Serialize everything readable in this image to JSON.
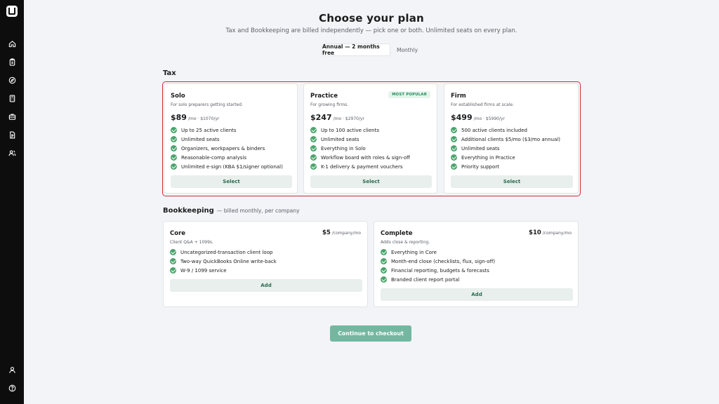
{
  "header": {
    "title": "Choose your plan",
    "subtitle": "Tax and Bookkeeping are billed independently — pick one or both. Unlimited seats on every plan."
  },
  "billing_toggle": {
    "annual_label": "Annual — 2 months free",
    "monthly_label": "Monthly",
    "selected": "annual"
  },
  "tax": {
    "section_label": "Tax",
    "plans": [
      {
        "name": "Solo",
        "description": "For solo preparers getting started.",
        "price": "$89",
        "price_unit": "/mo · $1070/yr",
        "features": [
          "Up to 25 active clients",
          "Unlimited seats",
          "Organizers, workpapers & binders",
          "Reasonable-comp analysis",
          "Unlimited e-sign (KBA $1/signer optional)"
        ],
        "button_label": "Select"
      },
      {
        "name": "Practice",
        "description": "For growing firms.",
        "badge": "MOST POPULAR",
        "price": "$247",
        "price_unit": "/mo · $2970/yr",
        "features": [
          "Up to 100 active clients",
          "Unlimited seats",
          "Everything in Solo",
          "Workflow board with roles & sign-off",
          "K-1 delivery & payment vouchers"
        ],
        "button_label": "Select"
      },
      {
        "name": "Firm",
        "description": "For established firms at scale.",
        "price": "$499",
        "price_unit": "/mo · $5990/yr",
        "features": [
          "500 active clients included",
          "Additional clients $5/mo ($3/mo annual)",
          "Unlimited seats",
          "Everything in Practice",
          "Priority support"
        ],
        "button_label": "Select"
      }
    ]
  },
  "bookkeeping": {
    "section_label": "Bookkeeping",
    "section_note": "— billed monthly, per company",
    "plans": [
      {
        "name": "Core",
        "description": "Client Q&A + 1099s.",
        "price": "$5",
        "price_unit": "/company/mo",
        "features": [
          "Uncategorized-transaction client loop",
          "Two-way QuickBooks Online write-back",
          "W-9 / 1099 service"
        ],
        "button_label": "Add"
      },
      {
        "name": "Complete",
        "description": "Adds close & reporting.",
        "price": "$10",
        "price_unit": "/company/mo",
        "features": [
          "Everything in Core",
          "Month-end close (checklists, flux, sign-off)",
          "Financial reporting, budgets & forecasts",
          "Branded client report portal"
        ],
        "button_label": "Add"
      }
    ]
  },
  "checkout": {
    "label": "Continue to checkout"
  },
  "sidebar": {
    "icons": [
      "logo-icon",
      "home-icon",
      "clipboard-icon",
      "compass-icon",
      "calculator-icon",
      "briefcase-icon",
      "document-icon",
      "users-icon",
      "user-icon",
      "help-icon"
    ]
  },
  "colors": {
    "accent_green": "#4aa46c",
    "checkout_button": "#74b7a0",
    "highlight_border": "#d62b35",
    "badge_text": "#1f8a58"
  }
}
